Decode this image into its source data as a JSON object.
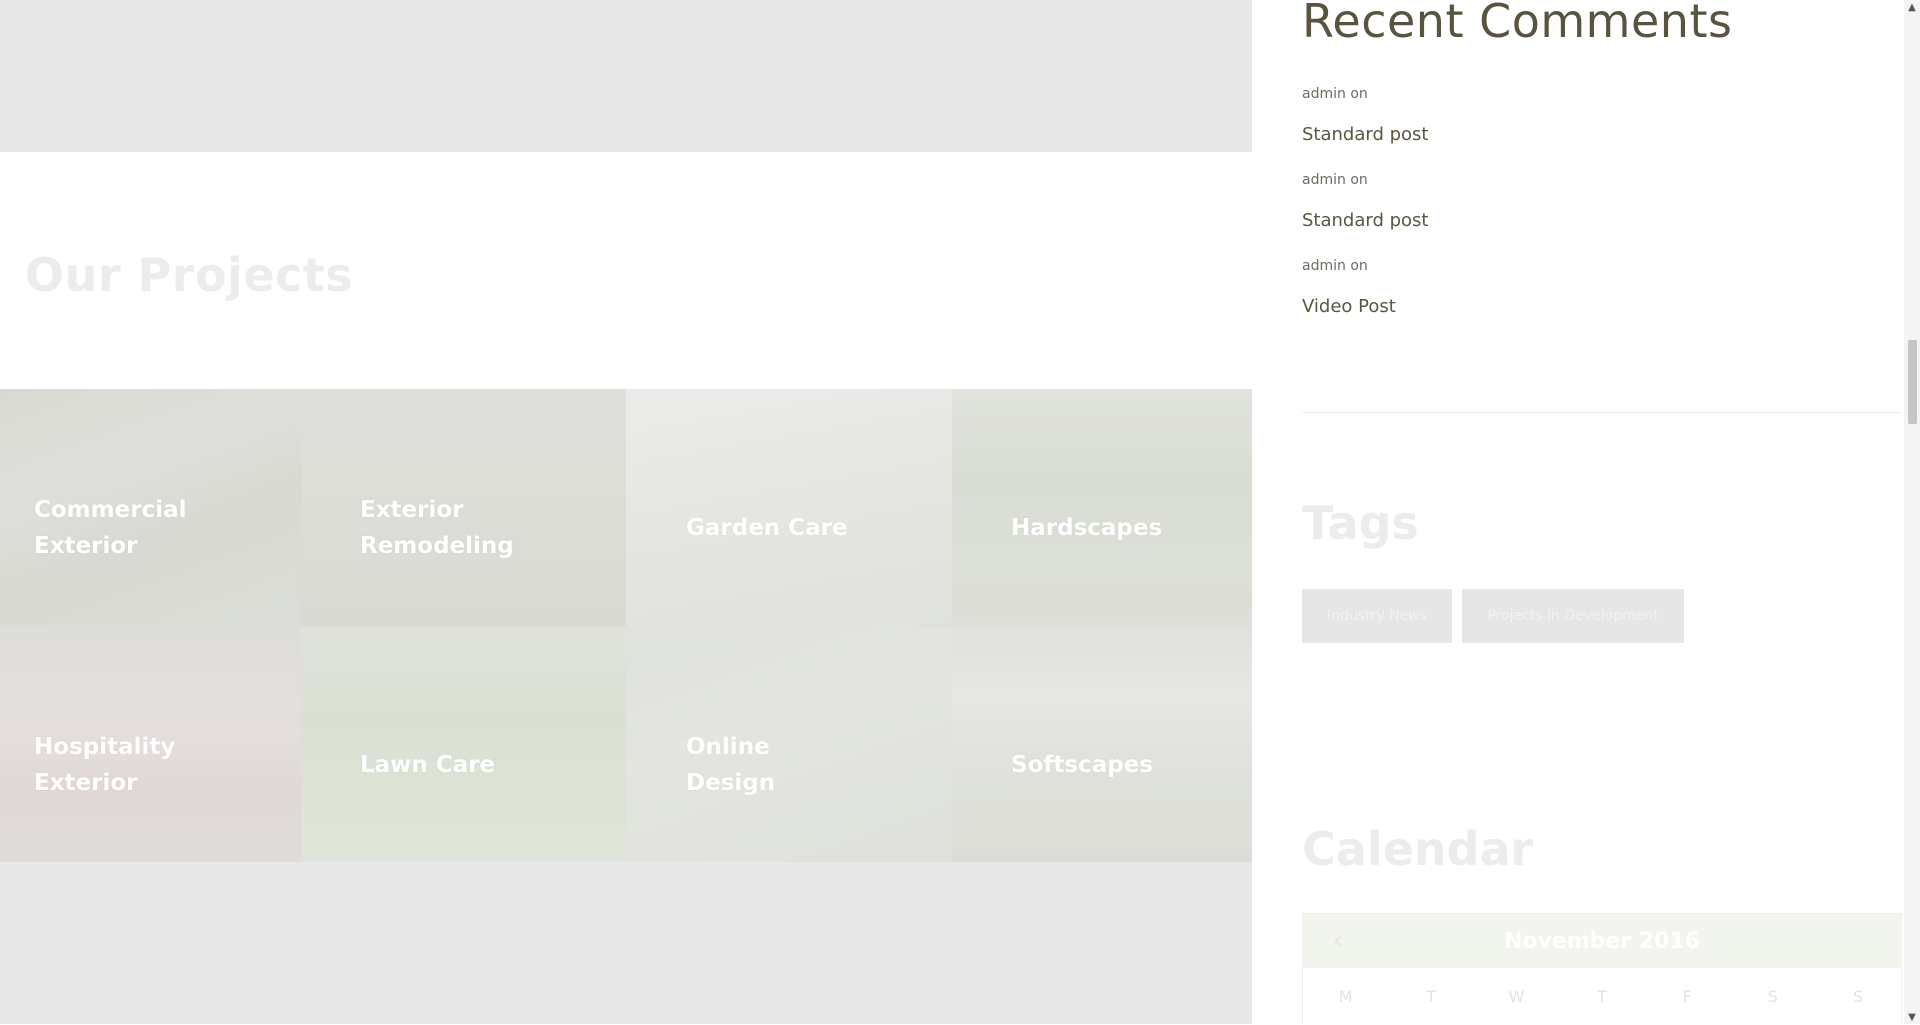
{
  "projects": {
    "title": "Our Projects",
    "tiles": [
      {
        "line1": "Commercial",
        "line2": "Exterior"
      },
      {
        "line1": "Exterior",
        "line2": "Remodeling"
      },
      {
        "line1": "Garden Care",
        "line2": ""
      },
      {
        "line1": "Hardscapes",
        "line2": ""
      },
      {
        "line1": "Hospitality",
        "line2": "Exterior"
      },
      {
        "line1": "Lawn Care",
        "line2": ""
      },
      {
        "line1": "Online",
        "line2": "Design"
      },
      {
        "line1": "Softscapes",
        "line2": ""
      }
    ]
  },
  "sidebar": {
    "recent_comments": {
      "title": "Recent Comments",
      "items": [
        {
          "meta": "admin on",
          "post": "Standard post"
        },
        {
          "meta": "admin on",
          "post": "Standard post"
        },
        {
          "meta": "admin on",
          "post": "Video Post"
        }
      ]
    },
    "tags": {
      "title": "Tags",
      "items": [
        "Industry News",
        "Projects in Development"
      ]
    },
    "calendar": {
      "title": "Calendar",
      "month": "November 2016",
      "prev_icon": "chevron-left-icon",
      "weekdays": [
        "M",
        "T",
        "W",
        "T",
        "F",
        "S",
        "S"
      ]
    }
  },
  "scrollbar": {
    "up_icon": "▲",
    "down_icon": "▼"
  }
}
